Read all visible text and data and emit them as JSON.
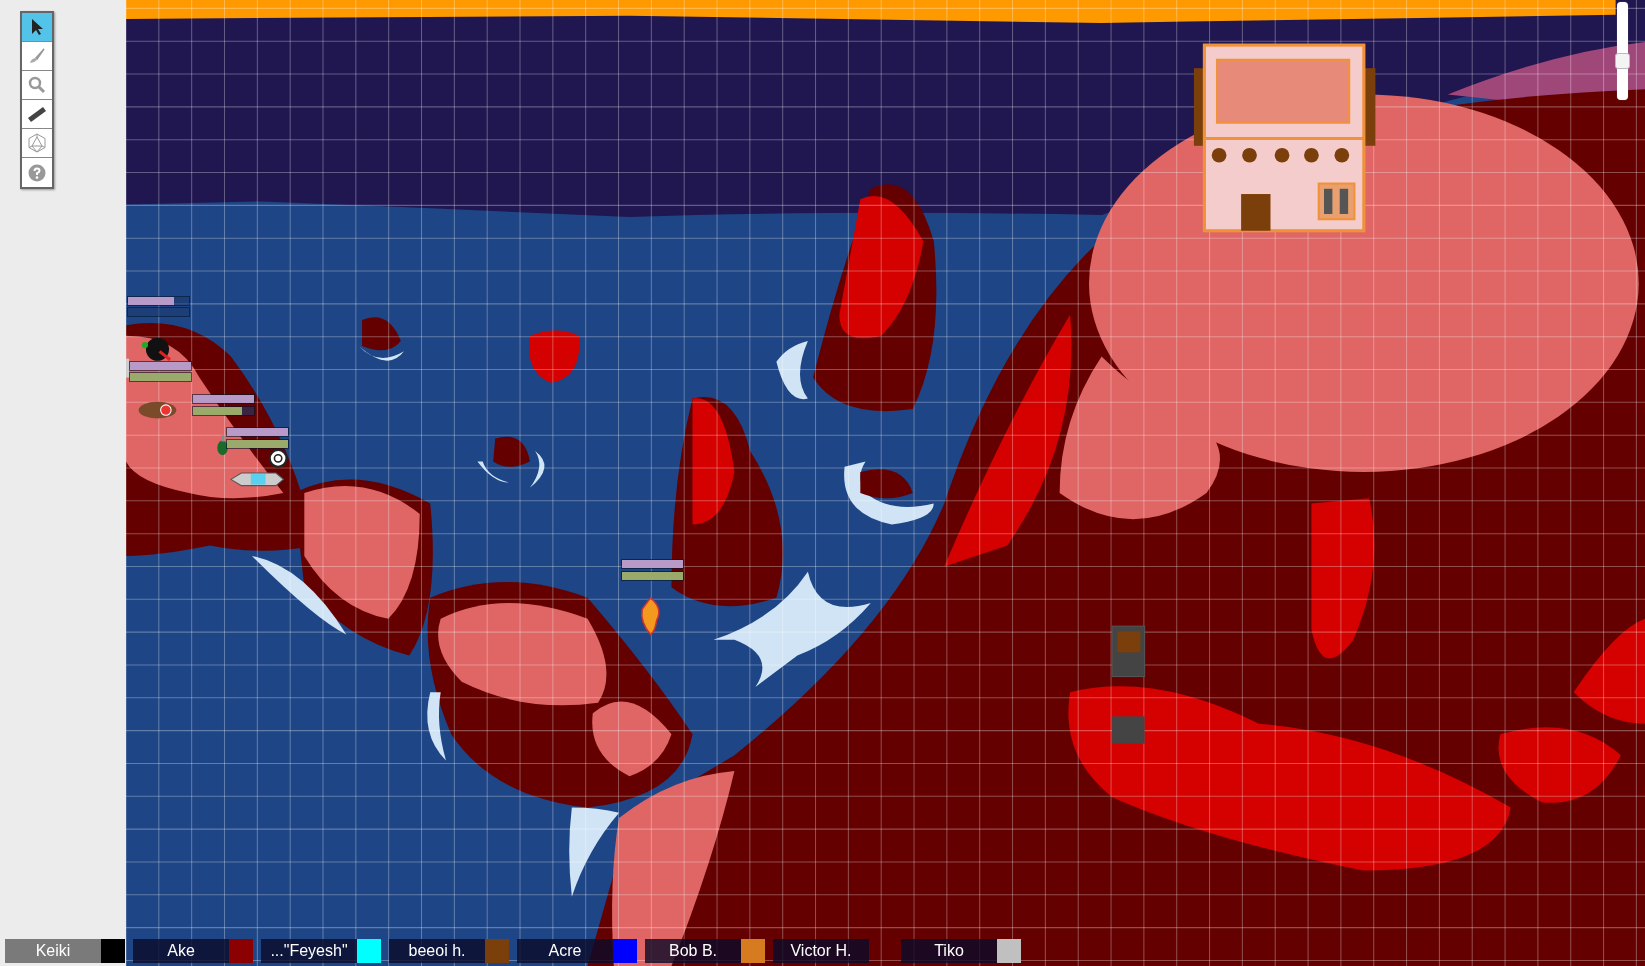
{
  "toolbar": {
    "tools": [
      {
        "kind": "select",
        "selected": true
      },
      {
        "kind": "brush",
        "selected": false
      },
      {
        "kind": "zoom",
        "selected": false
      },
      {
        "kind": "ruler",
        "selected": false
      },
      {
        "kind": "dice",
        "selected": false
      },
      {
        "kind": "help",
        "selected": false
      }
    ]
  },
  "zoom_slider": {
    "level": 0.38
  },
  "tokens": [
    {
      "kind": "ball",
      "bars": [
        {
          "level": 0.75
        },
        {
          "level": 0
        }
      ]
    },
    {
      "kind": "partial",
      "bars": [
        {
          "level": 1
        },
        {
          "level": 1
        }
      ]
    },
    {
      "kind": "bear",
      "bars": [
        {
          "level": 1
        },
        {
          "level": 0.8
        }
      ]
    },
    {
      "kind": "duck",
      "bars": [
        {
          "level": 1
        },
        {
          "level": 1
        }
      ]
    },
    {
      "kind": "snail"
    },
    {
      "kind": "rocket"
    },
    {
      "kind": "fire",
      "bars": [
        {
          "level": 1
        },
        {
          "level": 1
        }
      ]
    }
  ],
  "players": [
    {
      "name": "Keiki",
      "color": "#000000",
      "selected": true
    },
    {
      "name": "Ake",
      "color": "#8b0000",
      "selected": false
    },
    {
      "name": "...\"Feyesh\"",
      "color": "#00ffff",
      "selected": false
    },
    {
      "name": "beeoi h.",
      "color": "#7a3f0a",
      "selected": false
    },
    {
      "name": "Acre",
      "color": "#0000ff",
      "selected": false
    },
    {
      "name": "Bob B.",
      "color": "#d67b1f",
      "selected": false
    },
    {
      "name": "Victor H.",
      "selected": false
    },
    {
      "name": "Tiko",
      "color": "#c0c0c0",
      "selected": false
    }
  ]
}
